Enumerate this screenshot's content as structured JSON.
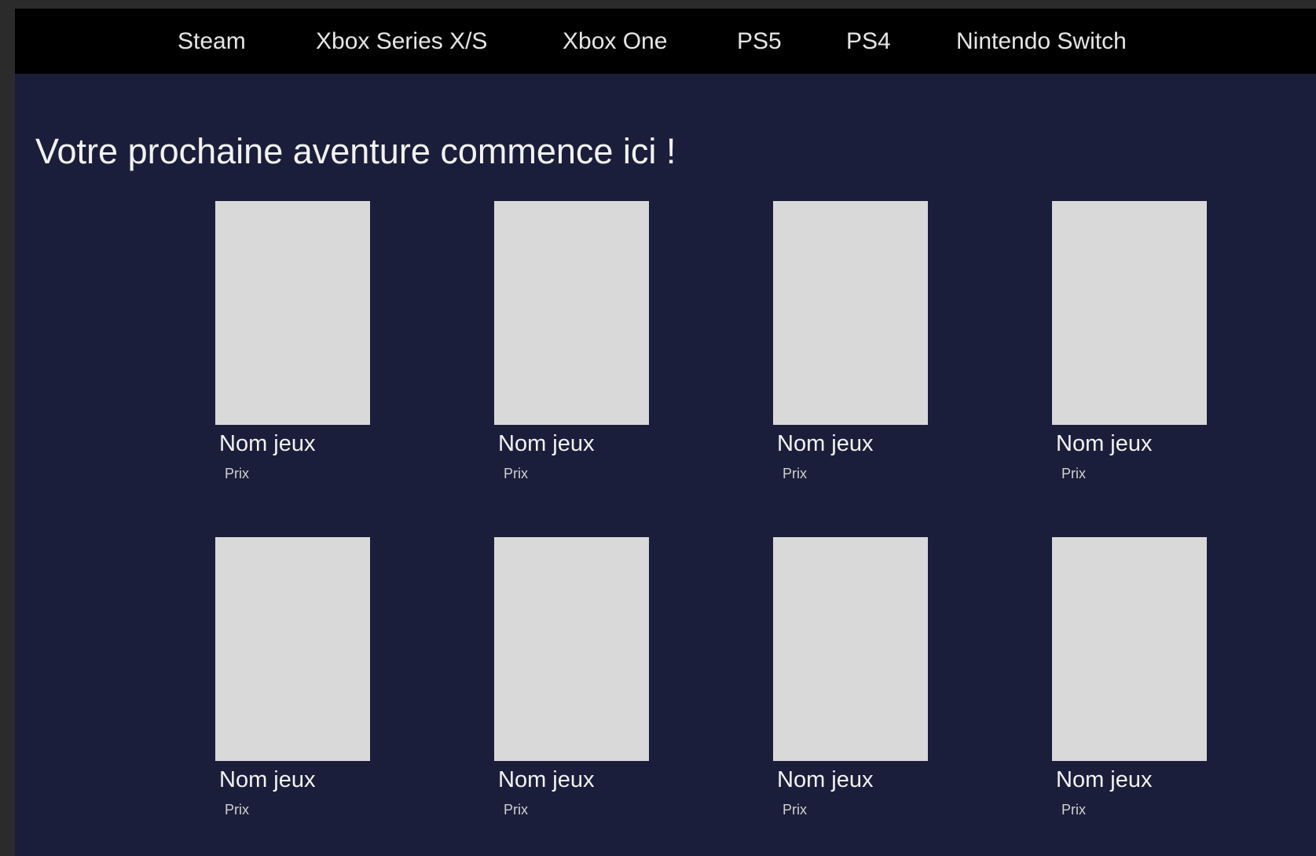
{
  "nav": {
    "items": [
      {
        "label": "Steam"
      },
      {
        "label": "Xbox Series X/S"
      },
      {
        "label": "Xbox One"
      },
      {
        "label": "PS5"
      },
      {
        "label": "PS4"
      },
      {
        "label": "Nintendo Switch"
      }
    ]
  },
  "main": {
    "headline": "Votre prochaine aventure commence ici !",
    "games": [
      {
        "name": "Nom jeux",
        "price": "Prix"
      },
      {
        "name": "Nom jeux",
        "price": "Prix"
      },
      {
        "name": "Nom jeux",
        "price": "Prix"
      },
      {
        "name": "Nom jeux",
        "price": "Prix"
      },
      {
        "name": "Nom jeux",
        "price": "Prix"
      },
      {
        "name": "Nom jeux",
        "price": "Prix"
      },
      {
        "name": "Nom jeux",
        "price": "Prix"
      },
      {
        "name": "Nom jeux",
        "price": "Prix"
      }
    ]
  },
  "colors": {
    "navbar_background": "#000000",
    "page_background": "#1b1e3b",
    "placeholder": "#d9d9d9",
    "text": "#f2f2f2"
  }
}
